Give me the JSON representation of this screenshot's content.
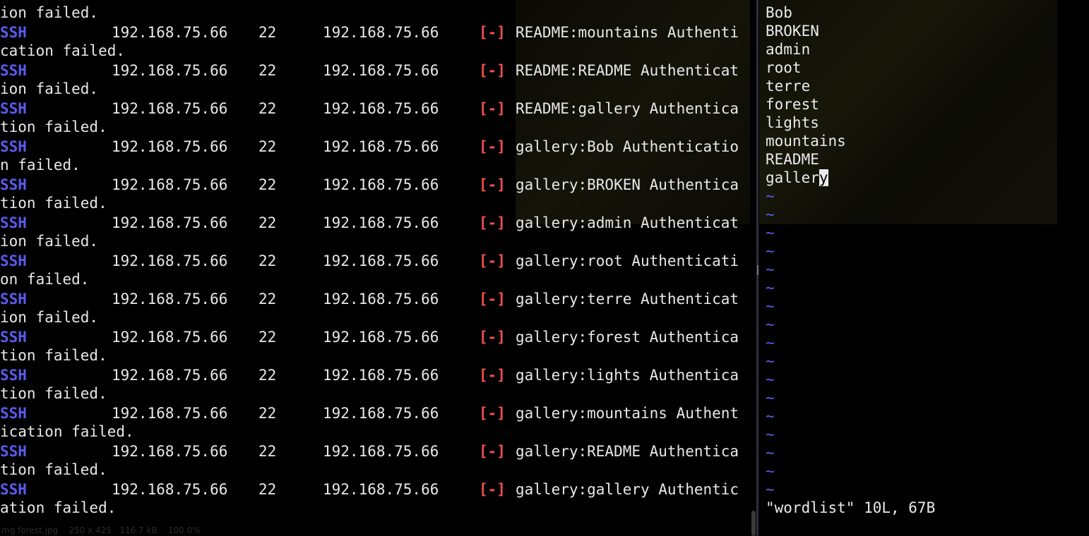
{
  "left_terminal": {
    "first_wrap": "ion failed.",
    "rows": [
      {
        "protocol": "SSH",
        "host": "192.168.75.66",
        "port": "22",
        "target": "192.168.75.66",
        "status": "[-]",
        "message": "README:mountains Authenti",
        "wrap": "cation failed."
      },
      {
        "protocol": "SSH",
        "host": "192.168.75.66",
        "port": "22",
        "target": "192.168.75.66",
        "status": "[-]",
        "message": "README:README Authenticat",
        "wrap": "ion failed."
      },
      {
        "protocol": "SSH",
        "host": "192.168.75.66",
        "port": "22",
        "target": "192.168.75.66",
        "status": "[-]",
        "message": "README:gallery Authentica",
        "wrap": "tion failed."
      },
      {
        "protocol": "SSH",
        "host": "192.168.75.66",
        "port": "22",
        "target": "192.168.75.66",
        "status": "[-]",
        "message": "gallery:Bob Authenticatio",
        "wrap": "n failed."
      },
      {
        "protocol": "SSH",
        "host": "192.168.75.66",
        "port": "22",
        "target": "192.168.75.66",
        "status": "[-]",
        "message": "gallery:BROKEN Authentica",
        "wrap": "tion failed."
      },
      {
        "protocol": "SSH",
        "host": "192.168.75.66",
        "port": "22",
        "target": "192.168.75.66",
        "status": "[-]",
        "message": "gallery:admin Authenticat",
        "wrap": "ion failed."
      },
      {
        "protocol": "SSH",
        "host": "192.168.75.66",
        "port": "22",
        "target": "192.168.75.66",
        "status": "[-]",
        "message": "gallery:root Authenticati",
        "wrap": "on failed."
      },
      {
        "protocol": "SSH",
        "host": "192.168.75.66",
        "port": "22",
        "target": "192.168.75.66",
        "status": "[-]",
        "message": "gallery:terre Authenticat",
        "wrap": "ion failed."
      },
      {
        "protocol": "SSH",
        "host": "192.168.75.66",
        "port": "22",
        "target": "192.168.75.66",
        "status": "[-]",
        "message": "gallery:forest Authentica",
        "wrap": "tion failed."
      },
      {
        "protocol": "SSH",
        "host": "192.168.75.66",
        "port": "22",
        "target": "192.168.75.66",
        "status": "[-]",
        "message": "gallery:lights Authentica",
        "wrap": "tion failed."
      },
      {
        "protocol": "SSH",
        "host": "192.168.75.66",
        "port": "22",
        "target": "192.168.75.66",
        "status": "[-]",
        "message": "gallery:mountains Authent",
        "wrap": "ication failed."
      },
      {
        "protocol": "SSH",
        "host": "192.168.75.66",
        "port": "22",
        "target": "192.168.75.66",
        "status": "[-]",
        "message": "gallery:README Authentica",
        "wrap": "tion failed."
      },
      {
        "protocol": "SSH",
        "host": "192.168.75.66",
        "port": "22",
        "target": "192.168.75.66",
        "status": "[-]",
        "message": "gallery:gallery Authentic",
        "wrap": "ation failed."
      }
    ],
    "image_caption": "mg forest.jpg    250 x 425   116.7 kB    100.0%"
  },
  "vim": {
    "lines": [
      "Bob",
      "BROKEN",
      "admin",
      "root",
      "terre",
      "forest",
      "lights",
      "mountains",
      "README"
    ],
    "cursor_line_before": "galler",
    "cursor_char": "y",
    "tilde": "~",
    "tilde_count": 17,
    "status": "\"wordlist\" 10L, 67B"
  },
  "colors": {
    "protocol": "#5b5bf0",
    "fail": "#ef4f4f",
    "tilde": "#5b5bf0",
    "text": "#e8e8e8",
    "background": "#000000"
  }
}
